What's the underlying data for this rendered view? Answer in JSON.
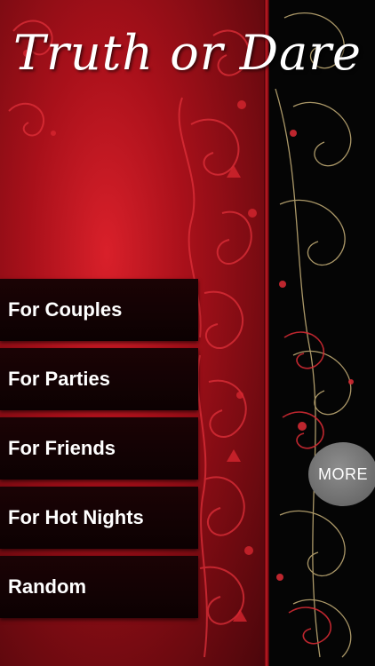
{
  "app": {
    "title": "Truth or Dare"
  },
  "menu": {
    "items": [
      {
        "label": "For Couples"
      },
      {
        "label": "For Parties"
      },
      {
        "label": "For Friends"
      },
      {
        "label": "For Hot Nights"
      },
      {
        "label": "Random"
      }
    ]
  },
  "more_button": {
    "label": "MORE"
  },
  "colors": {
    "background_red": "#a8101a",
    "background_black": "#050505",
    "menu_item_bg": "#1b0305",
    "more_button_bg": "#7a7a7a",
    "ornament_gold": "#c9b27a"
  }
}
